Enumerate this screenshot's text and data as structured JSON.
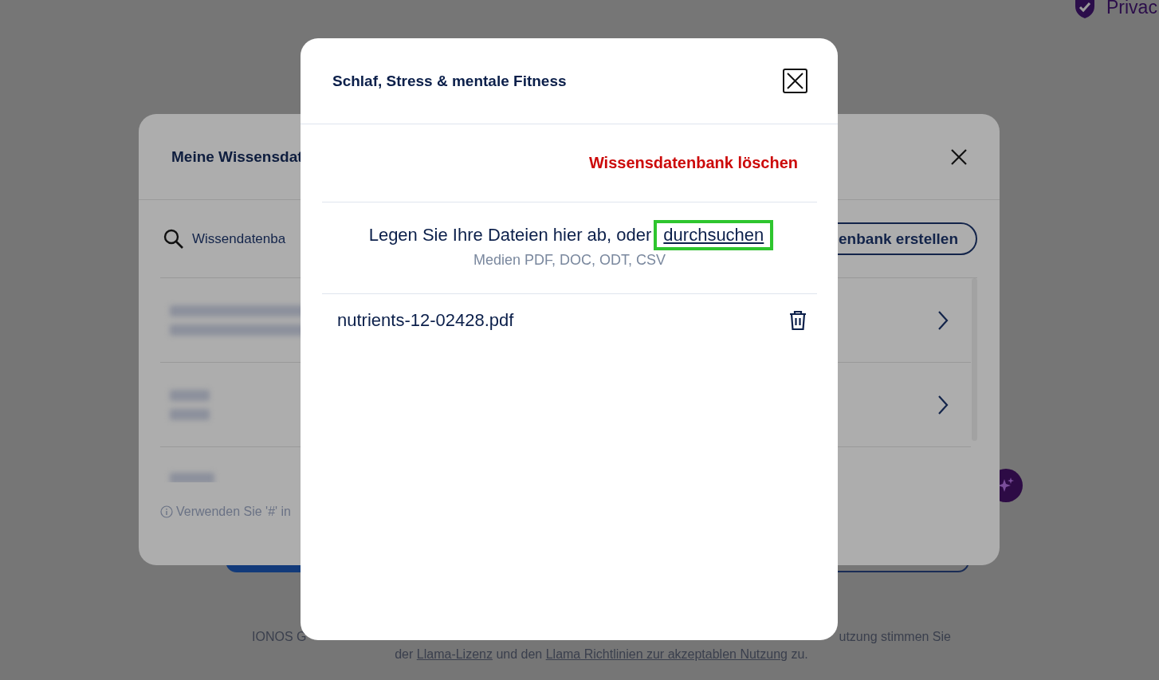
{
  "background_page": {
    "privacy_link": "Privac",
    "footer": {
      "line_1_left": "IONOS G",
      "line_1_right": "utzung stimmen Sie",
      "line_2": [
        {
          "kind": "text",
          "text": "der "
        },
        {
          "kind": "link",
          "text": "Llama-Lizenz"
        },
        {
          "kind": "text",
          "text": " und den "
        },
        {
          "kind": "link",
          "text": "Llama Richtlinien zur akzeptablen Nutzung"
        },
        {
          "kind": "text",
          "text": " zu."
        }
      ]
    }
  },
  "knowledge_base_dialog": {
    "title": "Meine Wissensdat",
    "search": {
      "placeholder": "Wissendatenba"
    },
    "create_button": "enbank erstellen",
    "hint": "Verwenden Sie '#' in"
  },
  "file_dialog": {
    "title": "Schlaf, Stress & mentale Fitness",
    "delete_link": "Wissensdatenbank löschen",
    "drop_zone": {
      "text": "Legen Sie Ihre Dateien hier ab, oder",
      "browse_link": "durchsuchen",
      "browse_highlighted": true,
      "formats": "Medien PDF, DOC, ODT, CSV"
    },
    "files": [
      {
        "name": "nutrients-12-02428.pdf"
      }
    ]
  }
}
